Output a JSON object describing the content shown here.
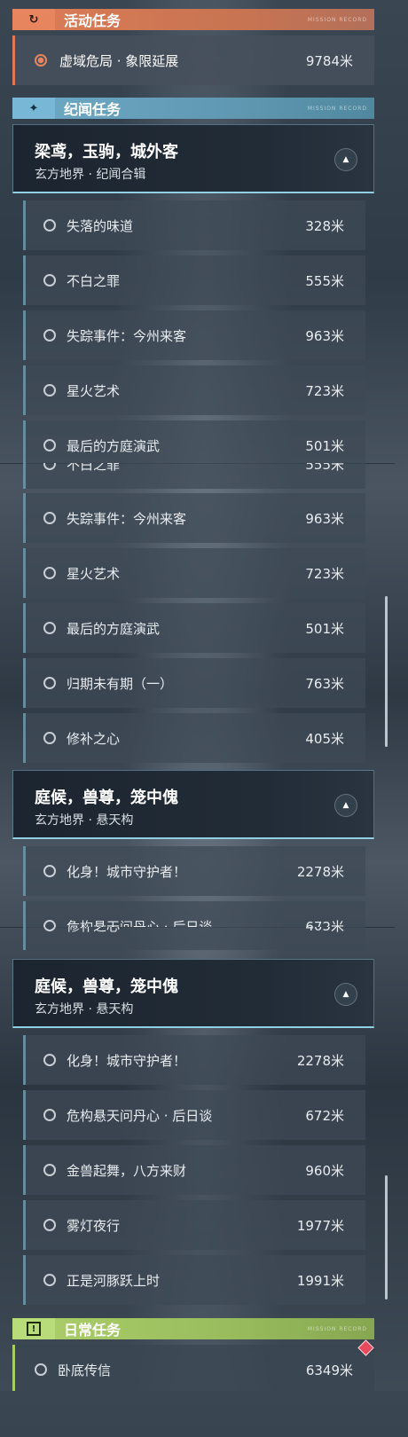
{
  "categories": {
    "activity": {
      "icon": "refresh-icon",
      "icon_glyph": "↻",
      "label": "活动任务",
      "color": "#e7855f"
    },
    "story": {
      "icon": "sparkle-icon",
      "icon_glyph": "✦",
      "label": "纪闻任务",
      "color": "#78b7d6"
    },
    "daily": {
      "icon": "alert-icon",
      "icon_glyph": "!",
      "label": "日常任务",
      "color": "#b9dc7b"
    },
    "deco_text": "MISSION RECORD"
  },
  "activity_quest": {
    "name": "虚域危局 · 象限延展",
    "distance": "9784米"
  },
  "groups": {
    "liangyuan": {
      "title": "梁鸢，玉驹，城外客",
      "subtitle": "玄方地界 · 纪闻合辑",
      "collapse_icon": "▲"
    },
    "tinghou": {
      "title": "庭候，兽尊，笼中傀",
      "subtitle": "玄方地界 · 悬天构",
      "collapse_icon": "▲"
    }
  },
  "quests": [
    {
      "name": "失落的味道",
      "distance": "328米"
    },
    {
      "name": "不白之罪",
      "distance": "555米"
    },
    {
      "name": "失踪事件：今州来客",
      "distance": "963米"
    },
    {
      "name": "星火艺术",
      "distance": "723米"
    },
    {
      "name": "最后的方庭演武",
      "distance": "501米"
    },
    {
      "name": "归期未有期（一）",
      "distance": "763米"
    },
    {
      "name": "修补之心",
      "distance": "405米"
    },
    {
      "name": "化身！城市守护者！",
      "distance": "2278米"
    },
    {
      "name": "危构悬天问丹心 · 后日谈",
      "distance": "672米"
    },
    {
      "name": "金兽起舞，八方来财",
      "distance": "960米"
    },
    {
      "name": "雾灯夜行",
      "distance": "1977米"
    },
    {
      "name": "正是河豚跃上时",
      "distance": "1991米"
    }
  ],
  "daily_quest": {
    "name": "卧底传信",
    "distance": "6349米"
  }
}
